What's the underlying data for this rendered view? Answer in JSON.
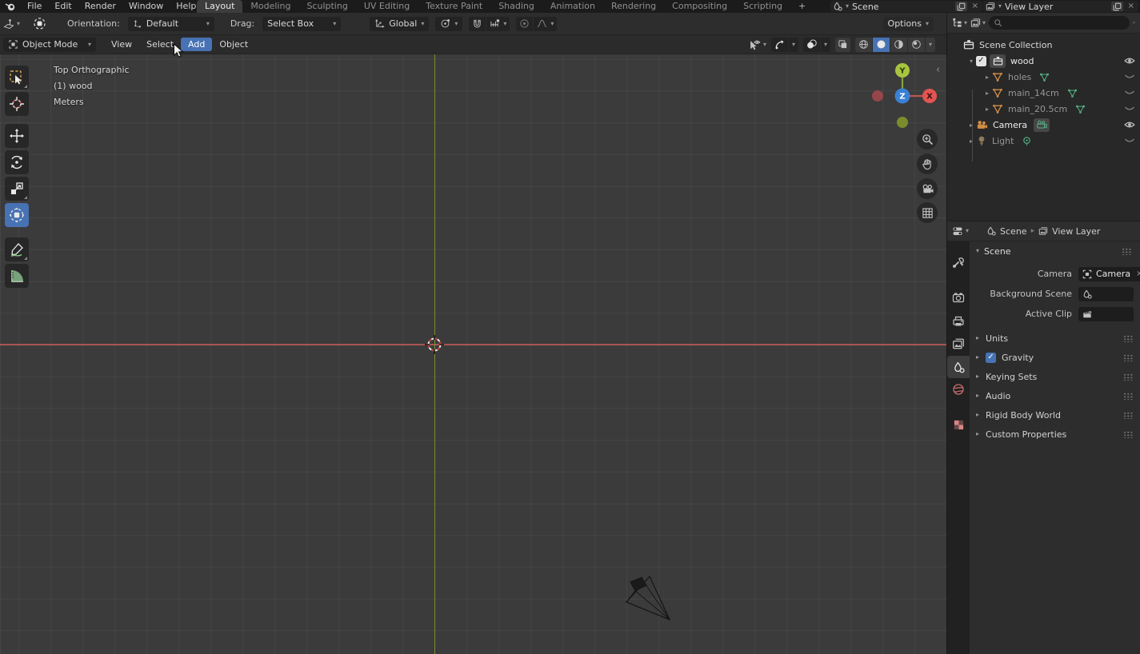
{
  "ui": {
    "chevron": "▾",
    "expand_open": "▾",
    "expand_closed": "▸",
    "close": "×",
    "breadcrumb_sep": "›",
    "collapse_arrow": "‹",
    "check": "✓",
    "plus": "+"
  },
  "topbar": {
    "menus": [
      "File",
      "Edit",
      "Render",
      "Window",
      "Help"
    ],
    "workspaces": [
      "Layout",
      "Modeling",
      "Sculpting",
      "UV Editing",
      "Texture Paint",
      "Shading",
      "Animation",
      "Rendering",
      "Compositing",
      "Scripting"
    ],
    "active_workspace": "Layout",
    "scene_selector": {
      "value": "Scene"
    },
    "view_layer_selector": {
      "value": "View Layer"
    }
  },
  "tool_settings": {
    "orientation_label": "Orientation:",
    "orientation_value": "Default",
    "drag_label": "Drag:",
    "drag_value": "Select Box",
    "transform_space": "Global",
    "options_label": "Options"
  },
  "viewport_header": {
    "mode": "Object Mode",
    "menus": [
      "View",
      "Select",
      "Add",
      "Object"
    ],
    "active_menu": "Add"
  },
  "viewport": {
    "overlay": {
      "view": "Top Orthographic",
      "active_object": "(1) wood",
      "units": "Meters"
    },
    "gizmo_axes": {
      "x": "X",
      "y": "Y",
      "z": "Z"
    }
  },
  "outliner": {
    "rows": [
      {
        "label": "Scene Collection",
        "type": "collection-root"
      },
      {
        "label": "wood",
        "type": "collection",
        "checked": true,
        "visibility": "visible"
      },
      {
        "label": "holes",
        "type": "mesh",
        "visibility": "hidden"
      },
      {
        "label": "main_14cm",
        "type": "mesh",
        "visibility": "hidden"
      },
      {
        "label": "main_20.5cm",
        "type": "mesh",
        "visibility": "hidden"
      },
      {
        "label": "Camera",
        "type": "camera",
        "visibility": "visible"
      },
      {
        "label": "Light",
        "type": "light",
        "visibility": "hidden"
      }
    ]
  },
  "properties": {
    "breadcrumb": {
      "scene": "Scene",
      "view_layer": "View Layer"
    },
    "panel_title": "Scene",
    "fields": {
      "camera_label": "Camera",
      "camera_value": "Camera",
      "background_scene_label": "Background Scene",
      "active_clip_label": "Active Clip"
    },
    "sections": [
      {
        "label": "Units"
      },
      {
        "label": "Gravity",
        "checked": true
      },
      {
        "label": "Keying Sets"
      },
      {
        "label": "Audio"
      },
      {
        "label": "Rigid Body World"
      },
      {
        "label": "Custom Properties"
      }
    ]
  },
  "colors": {
    "accent": "#4772b3",
    "axis_x": "#a84f4f",
    "axis_y": "#7c8c2f",
    "selection_orange": "#cf8d45",
    "data_green": "#56b385"
  }
}
